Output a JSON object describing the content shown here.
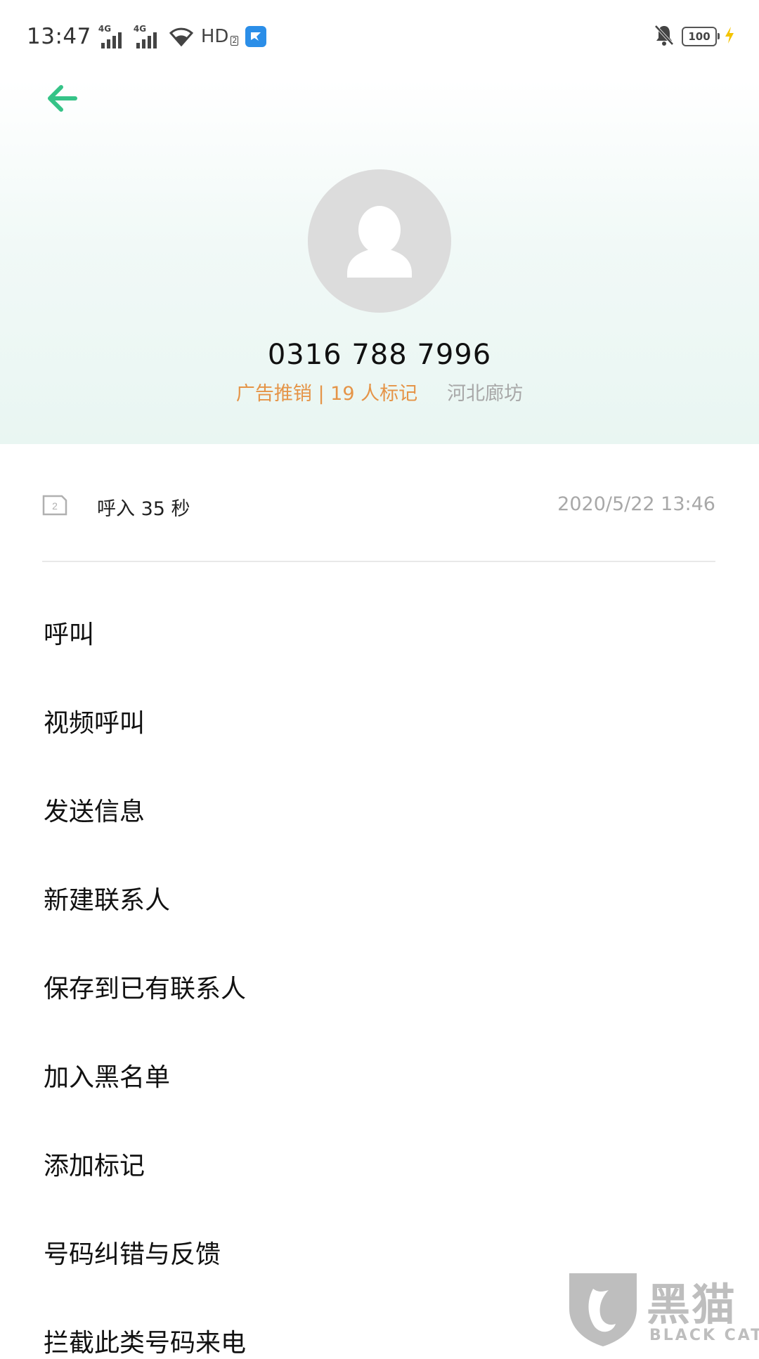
{
  "status_bar": {
    "time": "13:47",
    "network_1": "4G",
    "network_2": "4G",
    "hd_label": "HD",
    "hd_sub": "2",
    "battery_level": "100",
    "icons": [
      "wifi-icon",
      "app-badge-icon",
      "mute-bell-icon",
      "battery-icon",
      "charging-bolt-icon"
    ]
  },
  "contact": {
    "phone_number": "0316 788 7996",
    "tag": "广告推销 | 19 人标记",
    "location": "河北廊坊"
  },
  "call_record": {
    "sim_label": "2",
    "info": "呼入  35 秒",
    "timestamp": "2020/5/22 13:46"
  },
  "menu": {
    "items": [
      {
        "label": "呼叫"
      },
      {
        "label": "视频呼叫"
      },
      {
        "label": "发送信息"
      },
      {
        "label": "新建联系人"
      },
      {
        "label": "保存到已有联系人"
      },
      {
        "label": "加入黑名单"
      },
      {
        "label": "添加标记"
      },
      {
        "label": "号码纠错与反馈"
      },
      {
        "label": "拦截此类号码来电"
      }
    ]
  },
  "watermark": {
    "text": "黑猫",
    "sub": "BLACK CAT"
  },
  "colors": {
    "accent": "#35c387",
    "tag": "#e59447",
    "secondary_text": "#a8a8a8",
    "avatar_bg": "#dcdcdc"
  }
}
